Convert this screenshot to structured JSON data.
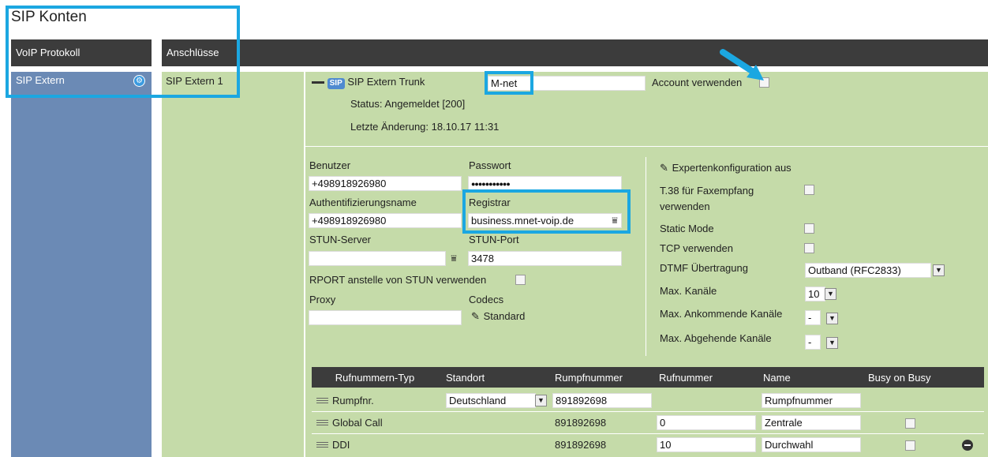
{
  "page_title": "SIP Konten",
  "header": {
    "left": "VoIP Protokoll",
    "right": "Anschlüsse"
  },
  "sidebar": {
    "items": [
      {
        "label": "SIP Extern"
      }
    ]
  },
  "connections": [
    {
      "label": "SIP Extern 1"
    }
  ],
  "trunk": {
    "badge": "SIP",
    "label": "SIP Extern Trunk",
    "name_value": "M-net",
    "account_label": "Account verwenden",
    "status": "Status: Angemeldet [200]",
    "last_change": "Letzte Änderung: 18.10.17 11:31"
  },
  "form": {
    "benutzer_label": "Benutzer",
    "benutzer_value": "+498918926980",
    "passwort_label": "Passwort",
    "passwort_value": "●●●●●●●●●●●",
    "auth_label": "Authentifizierungsname",
    "auth_value": "+498918926980",
    "registrar_label": "Registrar",
    "registrar_value": "business.mnet-voip.de",
    "stun_label": "STUN-Server",
    "stun_value": "",
    "stun_port_label": "STUN-Port",
    "stun_port_value": "3478",
    "rport_label": "RPORT anstelle von STUN verwenden",
    "proxy_label": "Proxy",
    "proxy_value": "",
    "codecs_label": "Codecs",
    "codecs_value": "Standard"
  },
  "expert": {
    "toggle_label": "Expertenkonfiguration aus",
    "t38_label_1": "T.38 für Faxempfang",
    "t38_label_2": "verwenden",
    "static_label": "Static Mode",
    "tcp_label": "TCP verwenden",
    "dtmf_label": "DTMF Übertragung",
    "dtmf_value": "Outband (RFC2833)",
    "max_channels_label": "Max. Kanäle",
    "max_channels_value": "10",
    "max_in_label": "Max. Ankommende Kanäle",
    "max_in_value": "-",
    "max_out_label": "Max. Abgehende Kanäle",
    "max_out_value": "-"
  },
  "table": {
    "columns": [
      "Rufnummern-Typ",
      "Standort",
      "Rumpfnummer",
      "Rufnummer",
      "Name",
      "Busy on Busy"
    ],
    "rows": [
      {
        "type": "Rumpfnr.",
        "standort": "Deutschland",
        "rumpf": "891892698",
        "nummer": "",
        "name": "Rumpfnummer"
      },
      {
        "type": "Global Call",
        "standort": "",
        "rumpf": "891892698",
        "nummer": "0",
        "name": "Zentrale"
      },
      {
        "type": "DDI",
        "standort": "",
        "rumpf": "891892698",
        "nummer": "10",
        "name": "Durchwahl"
      }
    ]
  },
  "colors": {
    "highlight": "#1ba7e1",
    "panel_green": "#c5dba9",
    "sidebar_blue": "#6b8ab5",
    "header_dark": "#3c3c3c"
  }
}
